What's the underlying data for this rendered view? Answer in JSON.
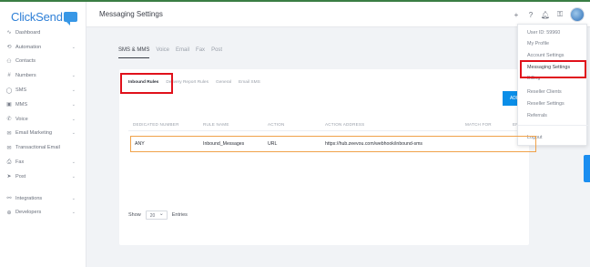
{
  "brand": {
    "name": "ClickSend"
  },
  "sidebar": {
    "items": [
      {
        "label": "Dashboard",
        "icon": "pulse-icon",
        "glyph": "∿",
        "chevron": false
      },
      {
        "label": "Automation",
        "icon": "automation-icon",
        "glyph": "⟲",
        "chevron": true
      },
      {
        "label": "Contacts",
        "icon": "contacts-icon",
        "glyph": "⚇",
        "chevron": false
      },
      {
        "label": "Numbers",
        "icon": "hash-icon",
        "glyph": "#",
        "chevron": true
      },
      {
        "label": "SMS",
        "icon": "chat-icon",
        "glyph": "◯",
        "chevron": true
      },
      {
        "label": "MMS",
        "icon": "image-icon",
        "glyph": "▣",
        "chevron": true
      },
      {
        "label": "Voice",
        "icon": "phone-icon",
        "glyph": "✆",
        "chevron": true
      },
      {
        "label": "Email Marketing",
        "icon": "email-icon",
        "glyph": "✉",
        "chevron": true
      },
      {
        "label": "Transactional Email",
        "icon": "transactional-email-icon",
        "glyph": "✉",
        "chevron": false
      },
      {
        "label": "Fax",
        "icon": "fax-icon",
        "glyph": "⎙",
        "chevron": true
      },
      {
        "label": "Post",
        "icon": "send-icon",
        "glyph": "➤",
        "chevron": true
      }
    ],
    "items2": [
      {
        "label": "Integrations",
        "icon": "integrations-icon",
        "glyph": "⚯",
        "chevron": true
      },
      {
        "label": "Developers",
        "icon": "developers-icon",
        "glyph": "⊕",
        "chevron": true
      }
    ]
  },
  "header": {
    "title": "Messaging Settings",
    "icons": [
      "plus-icon",
      "help-icon",
      "bell-icon",
      "key-icon"
    ]
  },
  "tabs": {
    "items": [
      "SMS & MMS",
      "Voice",
      "Email",
      "Fax",
      "Post"
    ],
    "active": "SMS & MMS"
  },
  "subtabs": {
    "items": [
      "Inbound Rules",
      "Delivery Report Rules",
      "General",
      "Email SMS"
    ],
    "active": "Inbound Rules"
  },
  "add_button": {
    "label": "ADD"
  },
  "table": {
    "columns": [
      "DEDICATED NUMBER",
      "RULE NAME",
      "ACTION",
      "ACTION ADDRESS",
      "MATCH FOR",
      "EN"
    ],
    "rows": [
      {
        "dedicated_number": "ANY",
        "rule_name": "Inbound_Messages",
        "action": "URL",
        "action_address": "https://hub.zeevou.com/webhook/inbound-sms",
        "match_for": ""
      }
    ]
  },
  "pagination": {
    "show_label": "Show",
    "page_size": "20",
    "entries_label": "Entries"
  },
  "user_menu": {
    "user_id": "User ID: 59960",
    "items": [
      "My Profile",
      "Account Settings",
      "Messaging Settings",
      "Billing",
      "Reseller Clients",
      "Reseller Settings",
      "Referrals"
    ],
    "logout": "Logout"
  },
  "colors": {
    "accent": "#0a8ee8",
    "brand": "#2f80d7",
    "highlight_red": "#e0111b",
    "highlight_orange": "#f0a24a"
  }
}
